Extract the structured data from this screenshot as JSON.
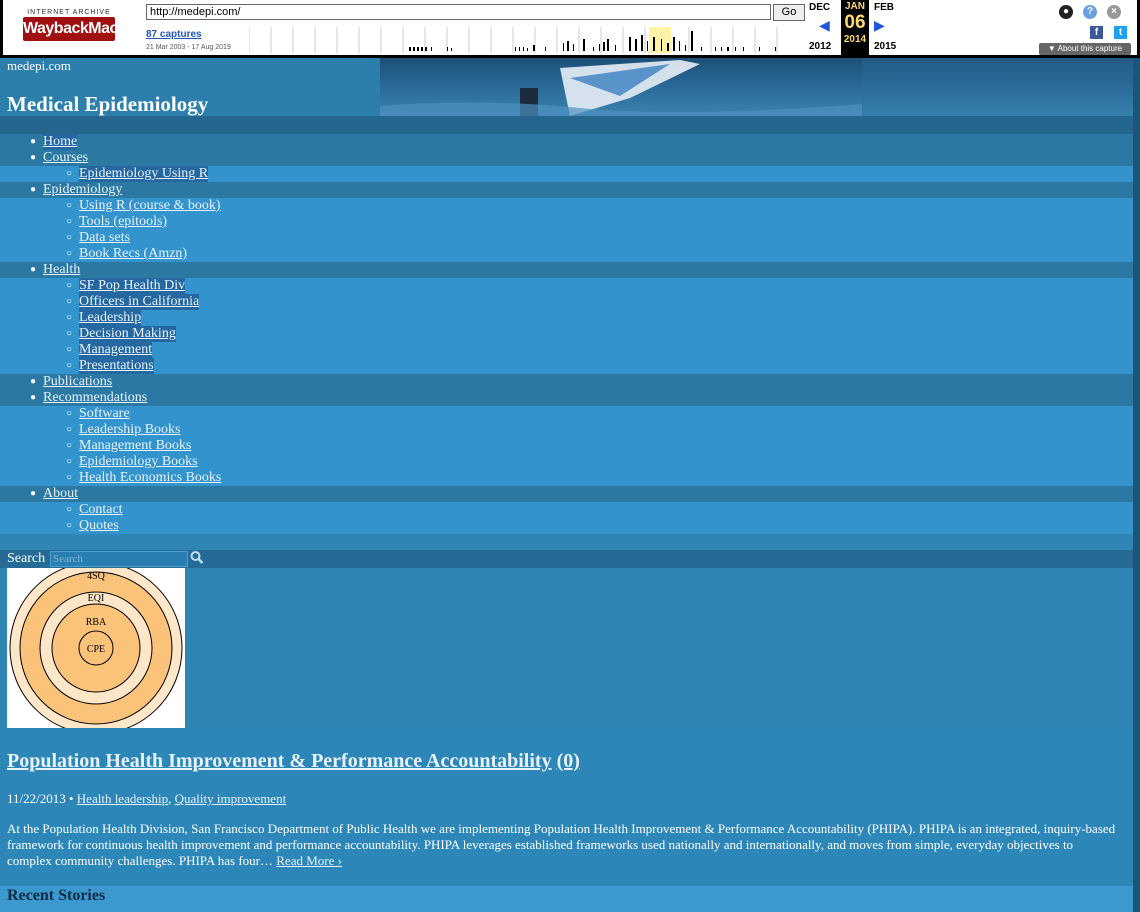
{
  "wayback": {
    "logo_top": "INTERNET ARCHIVE",
    "logo_main": "WaybackMachine",
    "url": "http://medepi.com/",
    "go": "Go",
    "captures": "87 captures",
    "range": "21 Mar 2003 - 17 Aug 2019",
    "prev_month": "DEC",
    "cur_month": "JAN",
    "next_month": "FEB",
    "cur_day": "06",
    "prev_year": "2012",
    "cur_year": "2014",
    "next_year": "2015",
    "about": "▼ About this capture",
    "icons": [
      "user-icon",
      "help-icon",
      "close-icon",
      "facebook-icon",
      "twitter-icon"
    ]
  },
  "header": {
    "site": "medepi.com",
    "title": "Medical Epidemiology"
  },
  "nav": [
    {
      "label": "Home",
      "level": 0
    },
    {
      "label": "Courses",
      "level": 0
    },
    {
      "label": "Epidemiology Using R",
      "level": 1
    },
    {
      "label": "Epidemiology",
      "level": 0
    },
    {
      "label": "Using R (course & book)",
      "level": 1
    },
    {
      "label": "Tools (epitools)",
      "level": 1
    },
    {
      "label": "Data sets",
      "level": 1
    },
    {
      "label": "Book Recs (Amzn)",
      "level": 1
    },
    {
      "label": "Health",
      "level": 0
    },
    {
      "label": "SF Pop Health Div",
      "level": 1
    },
    {
      "label": "Officers in California",
      "level": 1
    },
    {
      "label": "Leadership",
      "level": 1
    },
    {
      "label": "Decision Making",
      "level": 1
    },
    {
      "label": "Management",
      "level": 1
    },
    {
      "label": "Presentations",
      "level": 1
    },
    {
      "label": "Publications",
      "level": 0
    },
    {
      "label": "Recommendations",
      "level": 0
    },
    {
      "label": "Software",
      "level": 1
    },
    {
      "label": "Leadership Books",
      "level": 1
    },
    {
      "label": "Management Books",
      "level": 1
    },
    {
      "label": "Epidemiology Books",
      "level": 1
    },
    {
      "label": "Health Economics Books",
      "level": 1
    },
    {
      "label": "About",
      "level": 0
    },
    {
      "label": "Contact",
      "level": 1
    },
    {
      "label": "Quotes",
      "level": 1
    }
  ],
  "search": {
    "label": "Search",
    "placeholder": "Search"
  },
  "diagram": {
    "rings": [
      "4SQ",
      "EQI",
      "RBA",
      "CPE"
    ]
  },
  "article": {
    "title": "Population Health Improvement & Performance Accountability",
    "comments": "(0)",
    "date": "11/22/2013 •",
    "cat1": "Health leadership",
    "cat_sep": ",",
    "cat2": "Quality improvement",
    "body": "At the Population Health Division, San Francisco Department of Public Health we are implementing Population Health Improvement & Performance Accountability (PHIPA). PHIPA is an integrated, inquiry-based framework for continuous health improvement and performance accountability.  PHIPA leverages established frameworks used nationally and internationally, and moves from simple, everyday objectives to complex community challenges.  PHIPA has four…",
    "read_more": "Read More ›"
  },
  "recent": {
    "heading": "Recent Stories"
  },
  "colors": {
    "page_bg": "#2f86b4",
    "nav_top_row": "#2b78a3",
    "nav_sub_row": "#3393cc",
    "wayback_red": "#a01010",
    "calendar_yellow": "#ffd86c"
  }
}
